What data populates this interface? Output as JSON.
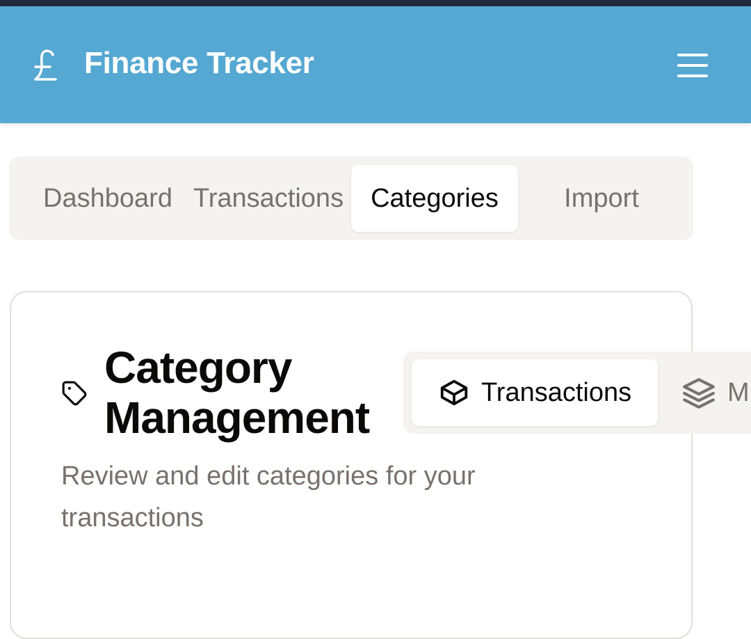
{
  "header": {
    "title": "Finance Tracker",
    "logo_icon": "pound-sign-icon",
    "menu_icon": "hamburger-menu-icon",
    "background": "#55a8d2"
  },
  "nav": {
    "tabs": [
      {
        "label": "Dashboard",
        "active": false
      },
      {
        "label": "Transactions",
        "active": false
      },
      {
        "label": "Categories",
        "active": true
      },
      {
        "label": "Import",
        "active": false
      }
    ]
  },
  "card": {
    "icon": "tag-icon",
    "title": "Category Management",
    "description": "Review and edit categories for your transactions"
  },
  "subtabs": [
    {
      "label": "Transactions",
      "icon": "box-icon",
      "active": true
    },
    {
      "label": "M",
      "icon": "layers-icon",
      "active": false
    }
  ]
}
